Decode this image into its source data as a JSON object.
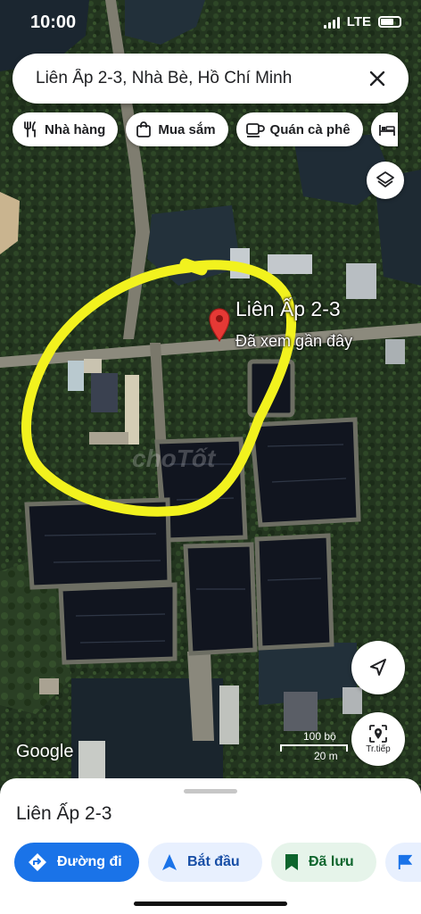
{
  "status_bar": {
    "time": "10:00",
    "network": "LTE"
  },
  "search": {
    "query": "Liên Ấp 2-3, Nhà Bè, Hồ Chí Minh"
  },
  "chips": [
    {
      "label": "Nhà hàng",
      "icon": "fork-knife-icon"
    },
    {
      "label": "Mua sắm",
      "icon": "shopping-bag-icon"
    },
    {
      "label": "Quán cà phê",
      "icon": "coffee-cup-icon"
    },
    {
      "label": "",
      "icon": "bed-icon"
    }
  ],
  "map": {
    "place_label": "Liên Ấp 2-3",
    "place_sublabel": "Đã xem gần đây",
    "attribution": "Google",
    "scale_imperial": "100 bộ",
    "scale_metric": "20 m",
    "watermark": "choTốt",
    "highlight_color": "#f2f21e",
    "pin_color": "#e53935"
  },
  "controls": {
    "layers_icon": "layers-icon",
    "locate_icon": "navigation-arrow-icon",
    "streetview_label": "Tr.tiếp"
  },
  "sheet": {
    "title": "Liên Ấp 2-3",
    "actions": [
      {
        "label": "Đường đi",
        "icon": "directions-icon"
      },
      {
        "label": "Bắt đầu",
        "icon": "navigation-arrow-icon"
      },
      {
        "label": "Đã lưu",
        "icon": "bookmark-icon"
      },
      {
        "label": "",
        "icon": "flag-icon"
      }
    ]
  },
  "colors": {
    "primary": "#1a73e8",
    "saved_bg": "#e6f4ea"
  }
}
